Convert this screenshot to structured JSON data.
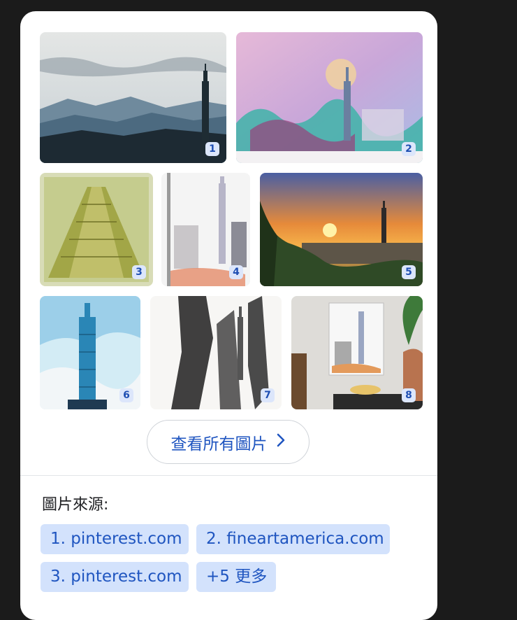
{
  "images": [
    {
      "number": "1",
      "subject": "taipei-101-mountains-photo"
    },
    {
      "number": "2",
      "subject": "taipei-101-watercolor-pink"
    },
    {
      "number": "3",
      "subject": "taipei-101-looking-up-vintage"
    },
    {
      "number": "4",
      "subject": "taipei-101-sketch-canvas"
    },
    {
      "number": "5",
      "subject": "taipei-sunset-skyline"
    },
    {
      "number": "6",
      "subject": "taipei-101-blue-watercolor"
    },
    {
      "number": "7",
      "subject": "taipei-101-ink-sketch"
    },
    {
      "number": "8",
      "subject": "taipei-101-framed-print-room"
    }
  ],
  "view_all": {
    "label": "查看所有圖片"
  },
  "sources": {
    "label": "圖片來源:",
    "chips": [
      {
        "text": "1. pinterest.com"
      },
      {
        "text": "2. fineartamerica.com"
      },
      {
        "text": "3. pinterest.com"
      },
      {
        "text": "+5 更多"
      }
    ]
  },
  "colors": {
    "accent": "#1f55c0",
    "chip_bg": "#d3e2fc",
    "badge_bg": "#dce6fb"
  }
}
